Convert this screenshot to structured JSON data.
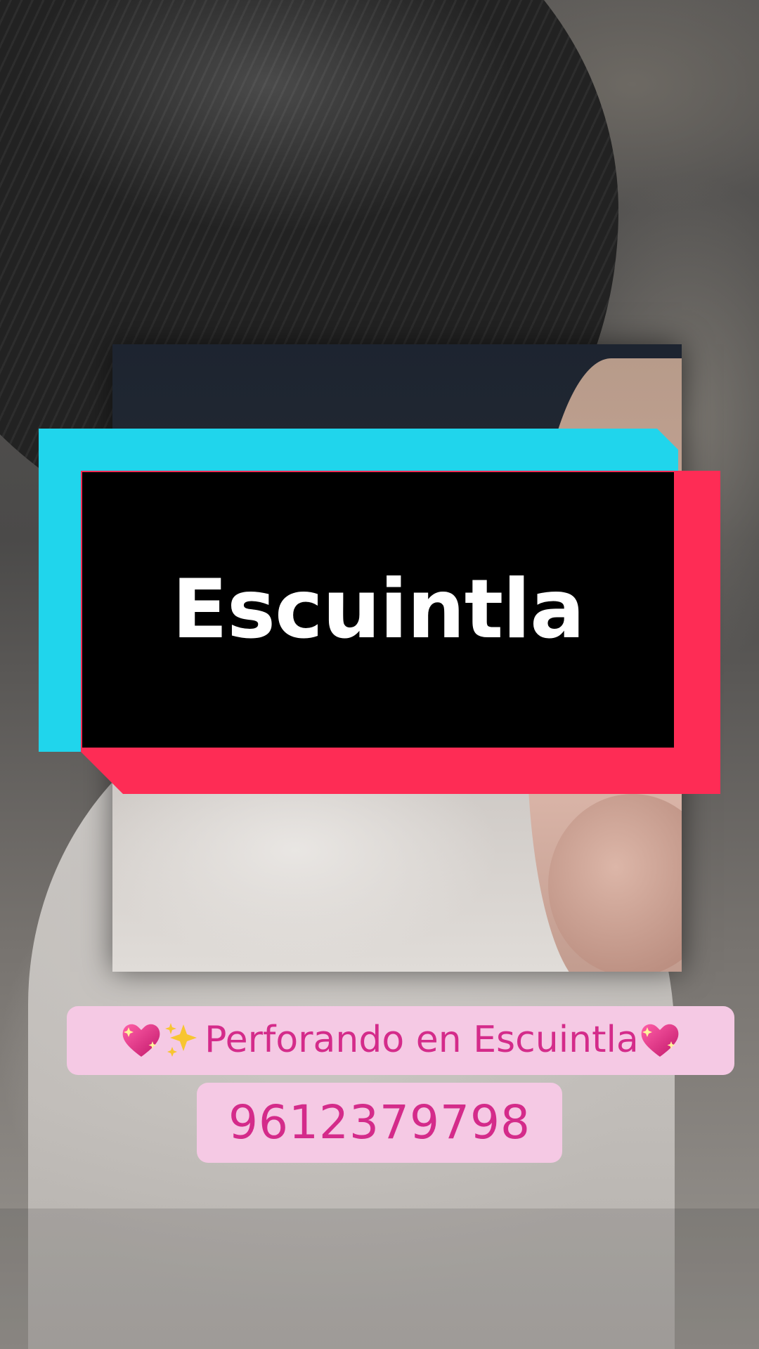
{
  "title_card": {
    "title": "Escuintla",
    "colors": {
      "cyan": "#20d5ec",
      "red": "#fe2c55",
      "black": "#000000",
      "text": "#ffffff"
    }
  },
  "caption": {
    "leading_icons": [
      "sparkling-heart-icon",
      "sparkles-icon"
    ],
    "text": "Perforando en Escuintla",
    "trailing_icon": "sparkling-heart-icon",
    "pill_color": "#f5c9e4",
    "text_color": "#d42b8a"
  },
  "phone": {
    "number": "9612379798"
  }
}
